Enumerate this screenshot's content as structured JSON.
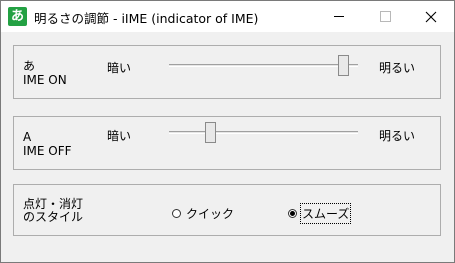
{
  "window": {
    "title": "明るさの調節 - iIME (indicator of IME)",
    "app_icon": "あ",
    "icon_color": "#23a143"
  },
  "ime_on": {
    "label_line1": "あ",
    "label_line2": "IME ON",
    "dark_label": "暗い",
    "bright_label": "明るい",
    "slider_value": 0.95
  },
  "ime_off": {
    "label_line1": "A",
    "label_line2": "IME OFF",
    "dark_label": "暗い",
    "bright_label": "明るい",
    "slider_value": 0.2
  },
  "style": {
    "label_line1": "点灯・消灯",
    "label_line2": "のスタイル",
    "options": [
      "クイック",
      "スムーズ"
    ],
    "selected": "スムーズ"
  }
}
